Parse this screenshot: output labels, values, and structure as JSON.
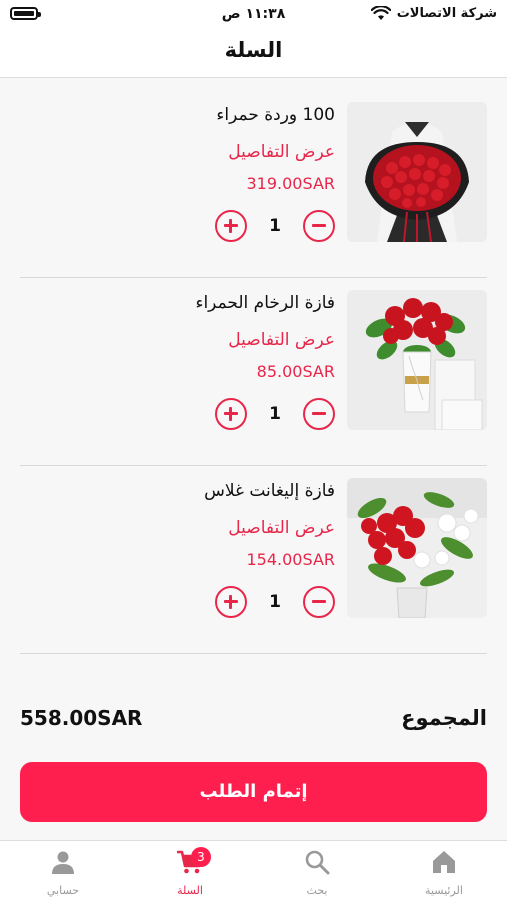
{
  "status_bar": {
    "time": "١١:٣٨ ص",
    "carrier": "شركة الاتصالات"
  },
  "header": {
    "title": "السلة"
  },
  "cart": {
    "details_label": "عرض التفاصيل",
    "items": [
      {
        "name": "100 وردة حمراء",
        "price": "319.00SAR",
        "quantity": "1",
        "image": "red-roses-bouquet"
      },
      {
        "name": "فازة الرخام الحمراء",
        "price": "85.00SAR",
        "quantity": "1",
        "image": "red-roses-marble-vase"
      },
      {
        "name": "فازة إليغانت غلاس",
        "price": "154.00SAR",
        "quantity": "1",
        "image": "roses-lilies-glass-vase"
      }
    ]
  },
  "summary": {
    "total_label": "المجموع",
    "total_value": "558.00SAR"
  },
  "checkout": {
    "label": "إتمام الطلب"
  },
  "tab_bar": {
    "tabs": [
      {
        "label": "الرئيسية",
        "icon": "home-icon"
      },
      {
        "label": "بحث",
        "icon": "search-icon"
      },
      {
        "label": "السلة",
        "icon": "cart-icon",
        "badge": "3",
        "active": true
      },
      {
        "label": "حسابي",
        "icon": "user-icon"
      }
    ]
  },
  "colors": {
    "accent": "#e8264a",
    "button": "#ff1f4e",
    "tab_inactive": "#999999"
  }
}
